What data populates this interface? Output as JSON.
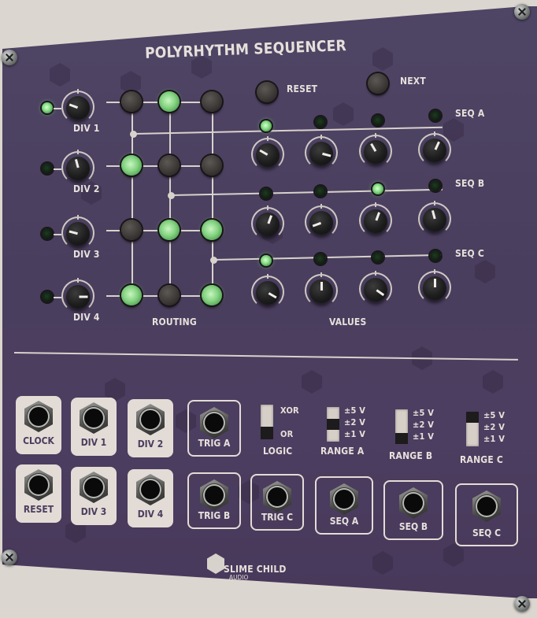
{
  "module": {
    "title": "POLYRHYTHM SEQUENCER",
    "brand": "SLIME CHILD",
    "brand_sub": "AUDIO",
    "colors": {
      "panel": "#4a3e5e",
      "text": "#e6e0db",
      "led_on": "#8ae088",
      "background": "#dcd6d0"
    }
  },
  "dividers": [
    {
      "label": "DIV 1",
      "led_on": true,
      "knob_angle_deg": -70
    },
    {
      "label": "DIV 2",
      "led_on": false,
      "knob_angle_deg": -15
    },
    {
      "label": "DIV 3",
      "led_on": false,
      "knob_angle_deg": -75
    },
    {
      "label": "DIV 4",
      "led_on": false,
      "knob_angle_deg": 90
    }
  ],
  "routing": {
    "label": "ROUTING",
    "grid": [
      [
        false,
        true,
        false
      ],
      [
        true,
        false,
        false
      ],
      [
        false,
        true,
        true
      ],
      [
        true,
        false,
        true
      ]
    ]
  },
  "buttons": {
    "reset": "RESET",
    "next": "NEXT"
  },
  "values": {
    "label": "VALUES",
    "sequences": [
      {
        "name": "SEQ A",
        "active_step": 0,
        "knob_angles_deg": [
          -60,
          105,
          -30,
          25
        ]
      },
      {
        "name": "SEQ B",
        "active_step": 2,
        "knob_angles_deg": [
          20,
          -110,
          20,
          -15
        ]
      },
      {
        "name": "SEQ C",
        "active_step": 0,
        "knob_angles_deg": [
          120,
          0,
          125,
          0
        ]
      }
    ]
  },
  "jacks_inputs": [
    {
      "label": "CLOCK"
    },
    {
      "label": "DIV 1"
    },
    {
      "label": "DIV 2"
    },
    {
      "label": "RESET"
    },
    {
      "label": "DIV 3"
    },
    {
      "label": "DIV 4"
    }
  ],
  "jacks_outputs": [
    {
      "label": "TRIG A"
    },
    {
      "label": "TRIG B"
    },
    {
      "label": "TRIG C"
    },
    {
      "label": "SEQ A"
    },
    {
      "label": "SEQ B"
    },
    {
      "label": "SEQ C"
    }
  ],
  "logic_switch": {
    "label": "LOGIC",
    "options": [
      "XOR",
      "OR"
    ],
    "selected": "OR"
  },
  "range_switches": [
    {
      "label": "RANGE A",
      "options": [
        "±5 V",
        "±2 V",
        "±1 V"
      ],
      "selected": "±2 V"
    },
    {
      "label": "RANGE B",
      "options": [
        "±5 V",
        "±2 V",
        "±1 V"
      ],
      "selected": "±1 V"
    },
    {
      "label": "RANGE C",
      "options": [
        "±5 V",
        "±2 V",
        "±1 V"
      ],
      "selected": "±5 V"
    }
  ]
}
